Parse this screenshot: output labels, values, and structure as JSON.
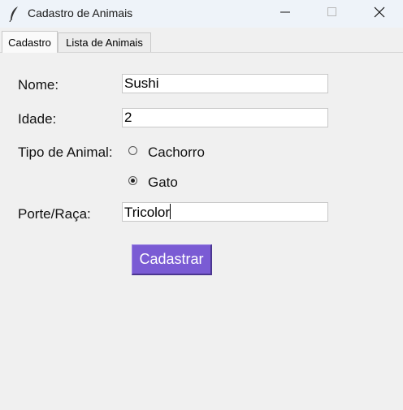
{
  "window": {
    "title": "Cadastro de Animais",
    "icon": "feather-icon",
    "controls": [
      "minimize-icon",
      "maximize-icon",
      "close-icon"
    ]
  },
  "tabs": [
    {
      "label": "Cadastro",
      "selected": true
    },
    {
      "label": "Lista de Animais",
      "selected": false
    }
  ],
  "form": {
    "nome_label": "Nome:",
    "nome_value": "Sushi",
    "idade_label": "Idade:",
    "idade_value": "2",
    "tipo_label": "Tipo de Animal:",
    "tipo_options": [
      {
        "label": "Cachorro",
        "checked": false
      },
      {
        "label": "Gato",
        "checked": true
      }
    ],
    "porte_label": "Porte/Raça:",
    "porte_value": "Tricolor",
    "submit_label": "Cadastrar"
  },
  "colors": {
    "button_bg": "#7a5bd4",
    "button_text": "#ffffff",
    "window_bg": "#f0f0f0",
    "titlebar_bg": "#eef3f9"
  }
}
